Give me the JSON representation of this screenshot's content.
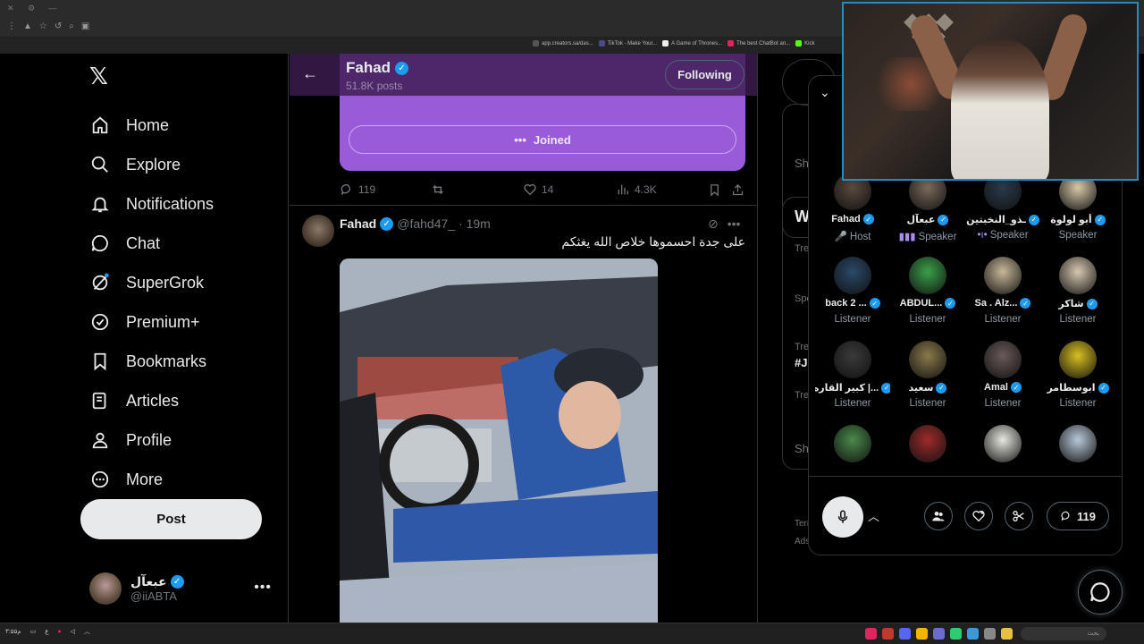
{
  "browser": {
    "bookmarks": [
      {
        "label": "app.creators.sa/das...",
        "color": "#555555"
      },
      {
        "label": "TikTok - Make Your...",
        "color": "#4a4a8a"
      },
      {
        "label": "A Game of Thrones...",
        "color": "#eeeeee"
      },
      {
        "label": "The best ChatBot an...",
        "color": "#e0245e"
      },
      {
        "label": "Kick",
        "color": "#53fc18"
      }
    ]
  },
  "sidebar": {
    "items": [
      {
        "label": "Home",
        "icon": "home-icon"
      },
      {
        "label": "Explore",
        "icon": "search-icon"
      },
      {
        "label": "Notifications",
        "icon": "bell-icon"
      },
      {
        "label": "Chat",
        "icon": "chat-icon"
      },
      {
        "label": "SuperGrok",
        "icon": "grok-icon"
      },
      {
        "label": "Premium+",
        "icon": "premium-icon"
      },
      {
        "label": "Bookmarks",
        "icon": "bookmark-icon"
      },
      {
        "label": "Articles",
        "icon": "articles-icon"
      },
      {
        "label": "Profile",
        "icon": "profile-icon"
      },
      {
        "label": "More",
        "icon": "more-icon"
      }
    ],
    "post_label": "Post",
    "account": {
      "name": "عبعآل",
      "handle": "@iiABTA"
    }
  },
  "header": {
    "name": "Fahad",
    "posts": "51.8K posts",
    "follow_label": "Following"
  },
  "space_card": {
    "joined_label": "Joined"
  },
  "tweet1": {
    "replies": "119",
    "likes": "14",
    "views": "4.3K"
  },
  "tweet2": {
    "name": "Fahad",
    "handle": "@fahd47_",
    "time": "· 19m",
    "text": "على جدة احسموها خلاص الله يغثكم"
  },
  "right": {
    "show_label": "Sh",
    "w_label": "W",
    "trend_labels": [
      "Tre",
      "Spo",
      "Tre",
      "#J",
      "Tre",
      "Sh"
    ],
    "footer": [
      "Terr",
      "Ads"
    ]
  },
  "spaces": {
    "members": [
      {
        "name": "Fahad",
        "role": "Host",
        "role_icon": "🎤",
        "bg": "#5a4a3e"
      },
      {
        "name": "عبعآل",
        "role": "Speaker",
        "role_icon": "▮▮▮",
        "bg": "#7a6a5a"
      },
      {
        "name": "ـذو_النخبتين",
        "role": "Speaker",
        "role_icon": "•ı•",
        "bg": "#2a3a4a"
      },
      {
        "name": "أبو لولوة",
        "role": "Speaker",
        "role_icon": "",
        "bg": "#d8c8a8"
      },
      {
        "name": "back 2 ...",
        "role": "Listener",
        "role_icon": "",
        "bg": "#2a4a6a"
      },
      {
        "name": "ABDUL...",
        "role": "Listener",
        "role_icon": "",
        "bg": "#3aa04a"
      },
      {
        "name": "Sa . Alz...",
        "role": "Listener",
        "role_icon": "",
        "bg": "#c8b898"
      },
      {
        "name": "شاكر",
        "role": "Listener",
        "role_icon": "",
        "bg": "#d8c8b0"
      },
      {
        "name": "كبير القاره |...",
        "role": "Listener",
        "role_icon": "",
        "bg": "#3a3a3a"
      },
      {
        "name": "سعيد",
        "role": "Listener",
        "role_icon": "",
        "bg": "#8a7a4a"
      },
      {
        "name": "Amal",
        "role": "Listener",
        "role_icon": "",
        "bg": "#6a5a58"
      },
      {
        "name": "ابوسطامر",
        "role": "Listener",
        "role_icon": "",
        "bg": "#d8c020"
      },
      {
        "name": "",
        "role": "",
        "role_icon": "",
        "bg": "#4a8a4a"
      },
      {
        "name": "",
        "role": "",
        "role_icon": "",
        "bg": "#a02a2a"
      },
      {
        "name": "",
        "role": "",
        "role_icon": "",
        "bg": "#e8e8e0"
      },
      {
        "name": "",
        "role": "",
        "role_icon": "",
        "bg": "#b8c8d8"
      }
    ],
    "reply_count": "119"
  },
  "taskbar": {
    "clock": "۳:۵۵م",
    "search_placeholder": "بحث"
  }
}
